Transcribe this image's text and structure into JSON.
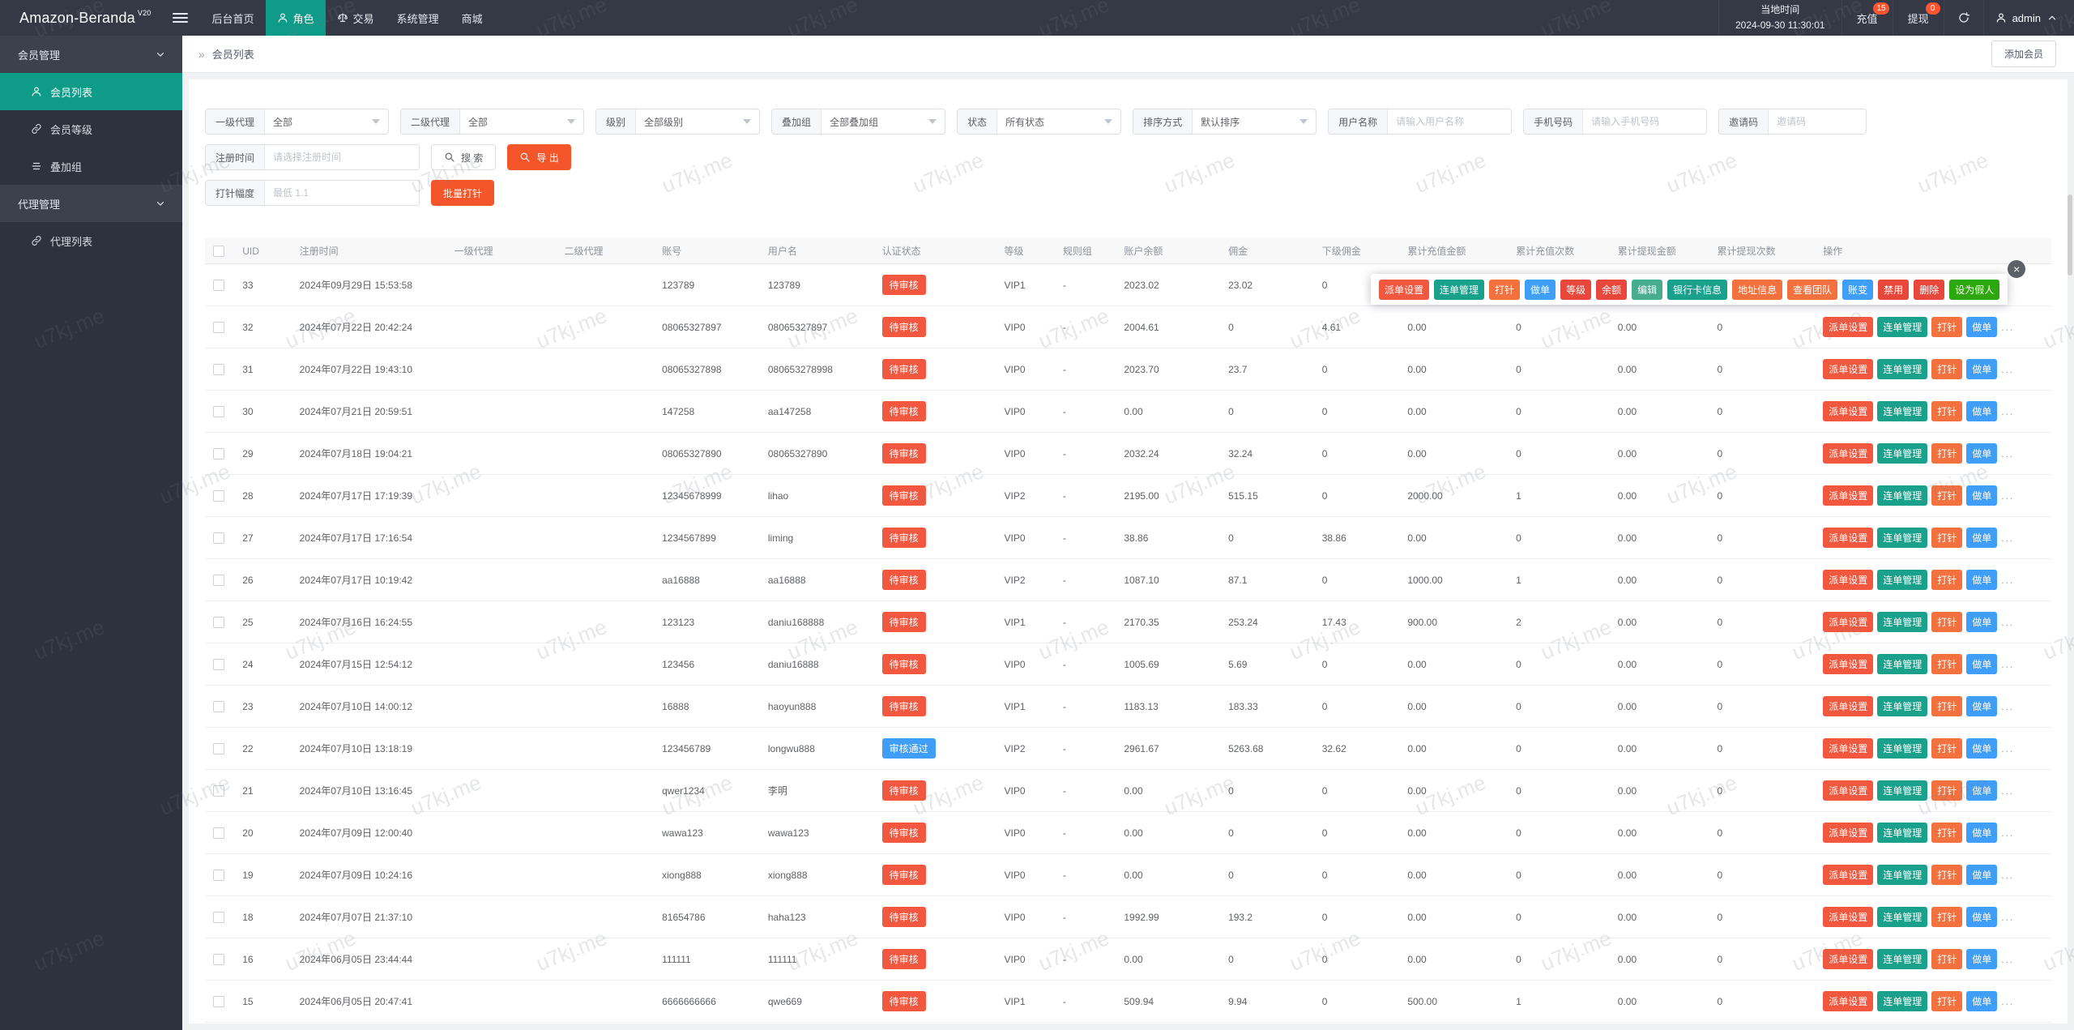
{
  "colors": {
    "navbar_bg": "#343945",
    "sidebar_bg": "#2d323d",
    "accent_teal": "#0e9c89",
    "navbar_badge_red": "#fb5531",
    "orange_button": "#f4552a",
    "status_pending": "#f2573f",
    "status_approved": "#3f9ef8"
  },
  "navbar": {
    "logo": "Amazon-Beranda",
    "logo_sup": "V20",
    "menu": [
      {
        "key": "dashboard",
        "label": "后台首页"
      },
      {
        "key": "roles",
        "label": "角色",
        "icon": "user",
        "active": true
      },
      {
        "key": "trade",
        "label": "交易",
        "icon": "scales"
      },
      {
        "key": "system",
        "label": "系统管理"
      },
      {
        "key": "mall",
        "label": "商城"
      }
    ],
    "local_time_label": "当地时间",
    "local_time_value": "2024-09-30 11:30:01",
    "recharge": {
      "label": "充值",
      "badge": "15"
    },
    "withdraw": {
      "label": "提现",
      "badge": "0"
    },
    "user": "admin"
  },
  "sidebar": {
    "items": [
      {
        "key": "member-management",
        "type": "group",
        "label": "会员管理"
      },
      {
        "key": "member-list",
        "type": "item",
        "icon": "user",
        "label": "会员列表",
        "active": true
      },
      {
        "key": "member-level",
        "type": "item",
        "icon": "link",
        "label": "会员等级"
      },
      {
        "key": "overlay-group",
        "type": "item",
        "icon": "list",
        "label": "叠加组"
      },
      {
        "key": "agent-management",
        "type": "group",
        "label": "代理管理"
      },
      {
        "key": "agent-list",
        "type": "item",
        "icon": "link",
        "label": "代理列表"
      }
    ]
  },
  "breadcrumb": "会员列表",
  "add_member_button": "添加会员",
  "filters": {
    "selects": [
      {
        "key": "agent1",
        "label": "一级代理",
        "value": "全部"
      },
      {
        "key": "agent2",
        "label": "二级代理",
        "value": "全部"
      },
      {
        "key": "level",
        "label": "级别",
        "value": "全部级别"
      },
      {
        "key": "overlay-group",
        "label": "叠加组",
        "value": "全部叠加组"
      },
      {
        "key": "status",
        "label": "状态",
        "value": "所有状态"
      },
      {
        "key": "sort",
        "label": "排序方式",
        "value": "默认排序"
      }
    ],
    "inputs": [
      {
        "key": "username",
        "label": "用户名称",
        "placeholder": "请输入用户名称"
      },
      {
        "key": "phone",
        "label": "手机号码",
        "placeholder": "请输入手机号码"
      },
      {
        "key": "invite-code",
        "label": "邀请码",
        "placeholder": "邀请码"
      }
    ],
    "register_time": {
      "label": "注册时间",
      "placeholder": "请选择注册时间"
    },
    "search_button": "搜 索",
    "export_button": "导 出",
    "needle": {
      "label": "打针幅度",
      "placeholder": "最低 1.1"
    },
    "batch_button": "批量打针"
  },
  "table": {
    "headers": [
      "UID",
      "注册时间",
      "一级代理",
      "二级代理",
      "账号",
      "用户名",
      "认证状态",
      "等级",
      "规则组",
      "账户余额",
      "佣金",
      "下级佣金",
      "累计充值金额",
      "累计充值次数",
      "累计提现金额",
      "累计提现次数",
      "操作"
    ],
    "status_colors": {
      "待审核": "#f2573f",
      "审核通过": "#3f9ef8"
    },
    "row_actions": [
      {
        "key": "dispatch-settings",
        "label": "派单设置",
        "color": "#f2573f"
      },
      {
        "key": "chain-orders",
        "label": "连单管理",
        "color": "#1aa18c"
      },
      {
        "key": "inject",
        "label": "打针",
        "color": "#f3713f"
      },
      {
        "key": "make-order",
        "label": "做单",
        "color": "#3f9ef8"
      }
    ],
    "more_label": "...",
    "rows": [
      {
        "uid": "33",
        "time": "2024年09月29日 15:53:58",
        "account": "123789",
        "username": "123789",
        "status": "待审核",
        "level": "VIP1",
        "rule": "-",
        "balance": "2023.02",
        "commission": "23.02",
        "sub_commission": "0",
        "recharge_total": "",
        "recharge_count": "",
        "withdraw_total": "",
        "withdraw_count": "",
        "actions_hidden": true
      },
      {
        "uid": "32",
        "time": "2024年07月22日 20:42:24",
        "account": "08065327897",
        "username": "08065327897",
        "status": "待审核",
        "level": "VIP0",
        "rule": "-",
        "balance": "2004.61",
        "commission": "0",
        "sub_commission": "4.61",
        "recharge_total": "0.00",
        "recharge_count": "0",
        "withdraw_total": "0.00",
        "withdraw_count": "0"
      },
      {
        "uid": "31",
        "time": "2024年07月22日 19:43:10",
        "account": "08065327898",
        "username": "080653278998",
        "status": "待审核",
        "level": "VIP0",
        "rule": "-",
        "balance": "2023.70",
        "commission": "23.7",
        "sub_commission": "0",
        "recharge_total": "0.00",
        "recharge_count": "0",
        "withdraw_total": "0.00",
        "withdraw_count": "0"
      },
      {
        "uid": "30",
        "time": "2024年07月21日 20:59:51",
        "account": "147258",
        "username": "aa147258",
        "status": "待审核",
        "level": "VIP0",
        "rule": "-",
        "balance": "0.00",
        "commission": "0",
        "sub_commission": "0",
        "recharge_total": "0.00",
        "recharge_count": "0",
        "withdraw_total": "0.00",
        "withdraw_count": "0"
      },
      {
        "uid": "29",
        "time": "2024年07月18日 19:04:21",
        "account": "08065327890",
        "username": "08065327890",
        "status": "待审核",
        "level": "VIP0",
        "rule": "-",
        "balance": "2032.24",
        "commission": "32.24",
        "sub_commission": "0",
        "recharge_total": "0.00",
        "recharge_count": "0",
        "withdraw_total": "0.00",
        "withdraw_count": "0"
      },
      {
        "uid": "28",
        "time": "2024年07月17日 17:19:39",
        "account": "12345678999",
        "username": "lihao",
        "status": "待审核",
        "level": "VIP2",
        "rule": "-",
        "balance": "2195.00",
        "commission": "515.15",
        "sub_commission": "0",
        "recharge_total": "2000.00",
        "recharge_count": "1",
        "withdraw_total": "0.00",
        "withdraw_count": "0"
      },
      {
        "uid": "27",
        "time": "2024年07月17日 17:16:54",
        "account": "1234567899",
        "username": "liming",
        "status": "待审核",
        "level": "VIP0",
        "rule": "-",
        "balance": "38.86",
        "commission": "0",
        "sub_commission": "38.86",
        "recharge_total": "0.00",
        "recharge_count": "0",
        "withdraw_total": "0.00",
        "withdraw_count": "0"
      },
      {
        "uid": "26",
        "time": "2024年07月17日 10:19:42",
        "account": "aa16888",
        "username": "aa16888",
        "status": "待审核",
        "level": "VIP2",
        "rule": "-",
        "balance": "1087.10",
        "commission": "87.1",
        "sub_commission": "0",
        "recharge_total": "1000.00",
        "recharge_count": "1",
        "withdraw_total": "0.00",
        "withdraw_count": "0"
      },
      {
        "uid": "25",
        "time": "2024年07月16日 16:24:55",
        "account": "123123",
        "username": "daniu168888",
        "status": "待审核",
        "level": "VIP1",
        "rule": "-",
        "balance": "2170.35",
        "commission": "253.24",
        "sub_commission": "17.43",
        "recharge_total": "900.00",
        "recharge_count": "2",
        "withdraw_total": "0.00",
        "withdraw_count": "0"
      },
      {
        "uid": "24",
        "time": "2024年07月15日 12:54:12",
        "account": "123456",
        "username": "daniu16888",
        "status": "待审核",
        "level": "VIP0",
        "rule": "-",
        "balance": "1005.69",
        "commission": "5.69",
        "sub_commission": "0",
        "recharge_total": "0.00",
        "recharge_count": "0",
        "withdraw_total": "0.00",
        "withdraw_count": "0"
      },
      {
        "uid": "23",
        "time": "2024年07月10日 14:00:12",
        "account": "16888",
        "username": "haoyun888",
        "status": "待审核",
        "level": "VIP1",
        "rule": "-",
        "balance": "1183.13",
        "commission": "183.33",
        "sub_commission": "0",
        "recharge_total": "0.00",
        "recharge_count": "0",
        "withdraw_total": "0.00",
        "withdraw_count": "0"
      },
      {
        "uid": "22",
        "time": "2024年07月10日 13:18:19",
        "account": "123456789",
        "username": "longwu888",
        "status": "审核通过",
        "level": "VIP2",
        "rule": "-",
        "balance": "2961.67",
        "commission": "5263.68",
        "sub_commission": "32.62",
        "recharge_total": "0.00",
        "recharge_count": "0",
        "withdraw_total": "0.00",
        "withdraw_count": "0"
      },
      {
        "uid": "21",
        "time": "2024年07月10日 13:16:45",
        "account": "qwer1234",
        "username": "李明",
        "status": "待审核",
        "level": "VIP0",
        "rule": "-",
        "balance": "0.00",
        "commission": "0",
        "sub_commission": "0",
        "recharge_total": "0.00",
        "recharge_count": "0",
        "withdraw_total": "0.00",
        "withdraw_count": "0"
      },
      {
        "uid": "20",
        "time": "2024年07月09日 12:00:40",
        "account": "wawa123",
        "username": "wawa123",
        "status": "待审核",
        "level": "VIP0",
        "rule": "-",
        "balance": "0.00",
        "commission": "0",
        "sub_commission": "0",
        "recharge_total": "0.00",
        "recharge_count": "0",
        "withdraw_total": "0.00",
        "withdraw_count": "0"
      },
      {
        "uid": "19",
        "time": "2024年07月09日 10:24:16",
        "account": "xiong888",
        "username": "xiong888",
        "status": "待审核",
        "level": "VIP0",
        "rule": "-",
        "balance": "0.00",
        "commission": "0",
        "sub_commission": "0",
        "recharge_total": "0.00",
        "recharge_count": "0",
        "withdraw_total": "0.00",
        "withdraw_count": "0"
      },
      {
        "uid": "18",
        "time": "2024年07月07日 21:37:10",
        "account": "81654786",
        "username": "haha123",
        "status": "待审核",
        "level": "VIP0",
        "rule": "-",
        "balance": "1992.99",
        "commission": "193.2",
        "sub_commission": "0",
        "recharge_total": "0.00",
        "recharge_count": "0",
        "withdraw_total": "0.00",
        "withdraw_count": "0"
      },
      {
        "uid": "16",
        "time": "2024年06月05日 23:44:44",
        "account": "111111",
        "username": "111111",
        "status": "待审核",
        "level": "VIP0",
        "rule": "-",
        "balance": "0.00",
        "commission": "0",
        "sub_commission": "0",
        "recharge_total": "0.00",
        "recharge_count": "0",
        "withdraw_total": "0.00",
        "withdraw_count": "0"
      },
      {
        "uid": "15",
        "time": "2024年06月05日 20:47:41",
        "account": "6666666666",
        "username": "qwe669",
        "status": "待审核",
        "level": "VIP1",
        "rule": "-",
        "balance": "509.94",
        "commission": "9.94",
        "sub_commission": "0",
        "recharge_total": "500.00",
        "recharge_count": "1",
        "withdraw_total": "0.00",
        "withdraw_count": "0"
      }
    ]
  },
  "popup": {
    "buttons": [
      {
        "key": "dispatch-settings",
        "label": "派单设置",
        "color": "#f2573f"
      },
      {
        "key": "chain-orders",
        "label": "连单管理",
        "color": "#1aa18c"
      },
      {
        "key": "inject",
        "label": "打针",
        "color": "#f3713f"
      },
      {
        "key": "make-order",
        "label": "做单",
        "color": "#3f9ef8"
      },
      {
        "key": "level",
        "label": "等级",
        "color": "#e8473b"
      },
      {
        "key": "balance",
        "label": "余额",
        "color": "#e8473b"
      },
      {
        "key": "edit",
        "label": "编辑",
        "color": "#47ad8d"
      },
      {
        "key": "bank-card-info",
        "label": "银行卡信息",
        "color": "#1aa18c"
      },
      {
        "key": "address-info",
        "label": "地址信息",
        "color": "#f3713f"
      },
      {
        "key": "view-team",
        "label": "查看团队",
        "color": "#f3713f"
      },
      {
        "key": "account-change",
        "label": "账变",
        "color": "#3f9ef8"
      },
      {
        "key": "disable",
        "label": "禁用",
        "color": "#e8473b"
      },
      {
        "key": "delete",
        "label": "删除",
        "color": "#e8473b"
      },
      {
        "key": "set-fake",
        "label": "设为假人",
        "color": "#2ca80e"
      }
    ],
    "close": "×"
  },
  "watermark": "u7kj.me"
}
